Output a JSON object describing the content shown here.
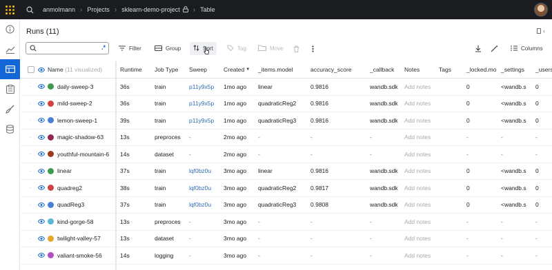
{
  "breadcrumb": {
    "user": "anmolmann",
    "section": "Projects",
    "project": "sklearn-demo-project",
    "view": "Table"
  },
  "panel": {
    "title": "Runs (11)"
  },
  "toolbar": {
    "search_placeholder": "",
    "regex_label": ".*",
    "filter": "Filter",
    "group": "Group",
    "sort": "Sort",
    "tag": "Tag",
    "move": "Move",
    "columns": "Columns"
  },
  "table": {
    "name_header": "Name",
    "name_count": "(11 visualized)",
    "headers": [
      "Runtime",
      "Job Type",
      "Sweep",
      "Created",
      "_items.model",
      "accuracy_score",
      "_callback",
      "Notes",
      "Tags",
      "_locked.mo",
      "_settings",
      "_users"
    ],
    "rows": [
      {
        "name": "daily-sweep-3",
        "color": "#3f9a4d",
        "cells": [
          "36s",
          "train",
          "p11y9x5p",
          "1mo ago",
          "linear",
          "0.9816",
          "wandb.sdk",
          "Add notes",
          "",
          "0",
          "<wandb.s",
          "0"
        ]
      },
      {
        "name": "mild-sweep-2",
        "color": "#d14343",
        "cells": [
          "36s",
          "train",
          "p11y9x5p",
          "1mo ago",
          "quadraticReg2",
          "0.9816",
          "wandb.sdk",
          "Add notes",
          "",
          "0",
          "<wandb.s",
          "0"
        ]
      },
      {
        "name": "lemon-sweep-1",
        "color": "#4a7fd4",
        "cells": [
          "39s",
          "train",
          "p11y9x5p",
          "1mo ago",
          "quadraticReg3",
          "0.9816",
          "wandb.sdk",
          "Add notes",
          "",
          "0",
          "<wandb.s",
          "0"
        ]
      },
      {
        "name": "magic-shadow-63",
        "color": "#8e2a52",
        "cells": [
          "13s",
          "preproces",
          "-",
          "2mo ago",
          "-",
          "-",
          "-",
          "Add notes",
          "",
          "-",
          "-",
          "-"
        ]
      },
      {
        "name": "youthful-mountain-6",
        "color": "#9a3b1e",
        "cells": [
          "14s",
          "dataset",
          "-",
          "2mo ago",
          "-",
          "-",
          "-",
          "Add notes",
          "",
          "-",
          "-",
          "-"
        ]
      },
      {
        "name": "linear",
        "color": "#3f9a4d",
        "cells": [
          "37s",
          "train",
          "lqf0bz0u",
          "3mo ago",
          "linear",
          "0.9816",
          "wandb.sdk",
          "Add notes",
          "",
          "0",
          "<wandb.s",
          "0"
        ]
      },
      {
        "name": "quadreg2",
        "color": "#d14343",
        "cells": [
          "38s",
          "train",
          "lqf0bz0u",
          "3mo ago",
          "quadraticReg2",
          "0.9817",
          "wandb.sdk",
          "Add notes",
          "",
          "0",
          "<wandb.s",
          "0"
        ]
      },
      {
        "name": "quadReg3",
        "color": "#4a7fd4",
        "cells": [
          "37s",
          "train",
          "lqf0bz0u",
          "3mo ago",
          "quadraticReg3",
          "0.9808",
          "wandb.sdk",
          "Add notes",
          "",
          "0",
          "<wandb.s",
          "0"
        ]
      },
      {
        "name": "kind-gorge-58",
        "color": "#5bb8d6",
        "cells": [
          "13s",
          "preproces",
          "-",
          "3mo ago",
          "-",
          "-",
          "-",
          "Add notes",
          "",
          "-",
          "-",
          "-"
        ]
      },
      {
        "name": "twilight-valley-57",
        "color": "#e5a72a",
        "cells": [
          "13s",
          "dataset",
          "-",
          "3mo ago",
          "-",
          "-",
          "-",
          "Add notes",
          "",
          "-",
          "-",
          "-"
        ]
      },
      {
        "name": "valiant-smoke-56",
        "color": "#b04fc0",
        "cells": [
          "14s",
          "logging",
          "-",
          "3mo ago",
          "-",
          "-",
          "-",
          "Add notes",
          "",
          "-",
          "-",
          "-"
        ]
      }
    ]
  },
  "icons": {
    "logo": "wandb-logo-icon",
    "search": "search-icon",
    "lock": "lock-icon",
    "info": "info-icon",
    "charts": "line-chart-icon",
    "table": "table-icon",
    "reports": "report-icon",
    "sweeps": "broom-icon",
    "artifacts": "database-icon",
    "filter": "filter-icon",
    "group": "group-icon",
    "sort": "sort-icon",
    "tag": "tag-icon",
    "move": "move-folder-icon",
    "delete": "trash-icon",
    "more": "more-vertical-icon",
    "download": "download-icon",
    "magic": "magic-wand-icon",
    "columns": "columns-icon",
    "eye": "eye-icon"
  },
  "colors": {
    "accent": "#1366d6",
    "topbar": "#1a1c1f",
    "logo": "#f5c518",
    "link": "#2f6fb8"
  }
}
